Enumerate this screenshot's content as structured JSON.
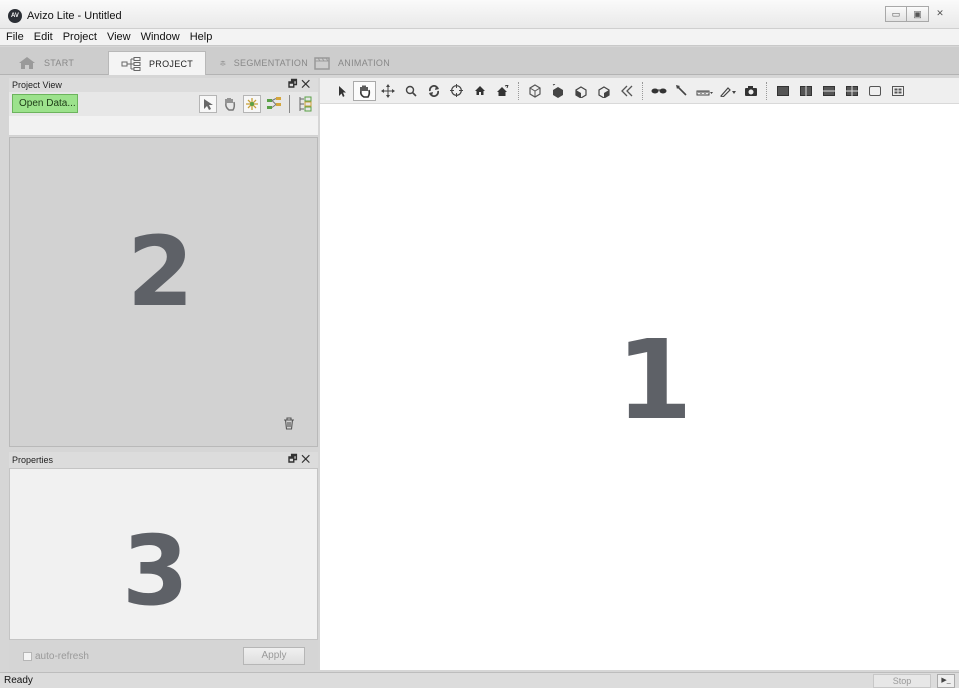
{
  "window": {
    "app_icon_text": "AV",
    "title": "Avizo Lite - Untitled",
    "minimize": "▭",
    "maximize": "▣",
    "close": "✕"
  },
  "menu": [
    "File",
    "Edit",
    "Project",
    "View",
    "Window",
    "Help"
  ],
  "tabs": [
    {
      "label": "START",
      "icon": "home-icon",
      "active": false
    },
    {
      "label": "PROJECT",
      "icon": "project-graph-icon",
      "active": true
    },
    {
      "label": "SEGMENTATION",
      "icon": "layers-icon",
      "active": false
    },
    {
      "label": "ANIMATION",
      "icon": "film-icon",
      "active": false
    }
  ],
  "project_view": {
    "title": "Project View",
    "float_icon": "🗗",
    "close_icon": "✕",
    "open_data_label": "Open Data...",
    "region_number": "2"
  },
  "properties": {
    "title": "Properties",
    "float_icon": "🗗",
    "close_icon": "✕",
    "region_number": "3",
    "auto_refresh_label": "auto-refresh",
    "apply_label": "Apply"
  },
  "viewer": {
    "region_number": "1",
    "background": "#ffffff"
  },
  "status": {
    "text": "Ready",
    "stop_label": "Stop",
    "console_icon": "▶_"
  },
  "colors": {
    "open_data_green": "#9ce28c",
    "region_number": "#5e6167"
  }
}
